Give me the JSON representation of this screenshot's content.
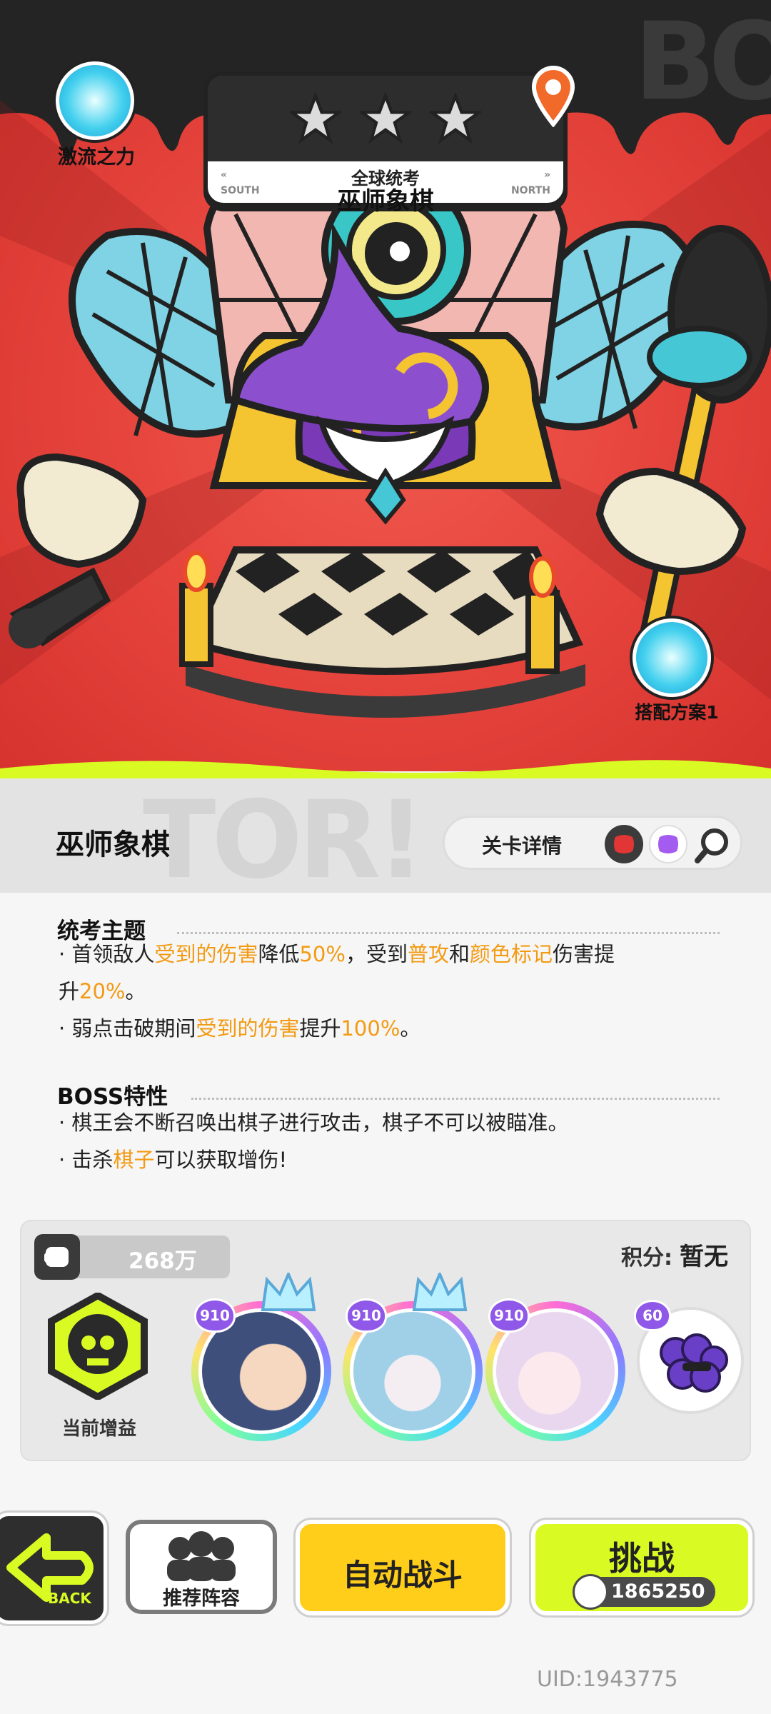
{
  "stage": {
    "name": "巫师象棋",
    "category": "全球统考",
    "direction_left": "SOUTH",
    "direction_right": "NORTH",
    "stars": 3
  },
  "badges": {
    "power_label": "激流之力",
    "plan_label": "搭配方案1"
  },
  "panel": {
    "title": "巫师象棋",
    "details_label": "关卡详情",
    "theme": {
      "heading": "统考主题",
      "bullets": [
        [
          {
            "t": "·  首领敌人"
          },
          {
            "t": "受到的伤害",
            "hl": true
          },
          {
            "t": "降低"
          },
          {
            "t": "50%",
            "hl": true
          },
          {
            "t": "，受到"
          },
          {
            "t": "普攻",
            "hl": true
          },
          {
            "t": "和"
          },
          {
            "t": "颜色标记",
            "hl": true
          },
          {
            "t": "伤害提"
          }
        ],
        [
          {
            "t": "升"
          },
          {
            "t": "20%",
            "hl": true
          },
          {
            "t": "。"
          }
        ],
        [
          {
            "t": "·  弱点击破期间"
          },
          {
            "t": "受到的伤害",
            "hl": true
          },
          {
            "t": "提升"
          },
          {
            "t": "100%",
            "hl": true
          },
          {
            "t": "。"
          }
        ]
      ]
    },
    "boss": {
      "heading": "BOSS特性",
      "bullets": [
        [
          {
            "t": "·  棋王会不断召唤出棋子进行攻击，棋子不可以被瞄准。"
          }
        ],
        [
          {
            "t": "·  击杀"
          },
          {
            "t": "棋子",
            "hl": true
          },
          {
            "t": "可以获取增伤!"
          }
        ]
      ]
    }
  },
  "team": {
    "power": "268万",
    "score_label": "积分:",
    "score_value": "暂无",
    "buff_label": "当前增益",
    "heroes": [
      {
        "level": "910",
        "face": "#3d4f7a"
      },
      {
        "level": "910",
        "face": "#9fd0e8"
      },
      {
        "level": "910",
        "face": "#e9d6ef"
      }
    ],
    "pet_level": "60"
  },
  "buttons": {
    "back": "BACK",
    "recommend": "推荐阵容",
    "auto": "自动战斗",
    "fight": "挑战",
    "fight_power": "1865250"
  },
  "uid": "UID:1943775",
  "colors": {
    "highlight": "#f39a12",
    "hero_bg": "#e7463e",
    "lime": "#d9fb23",
    "auto_yellow": "#ffce1a"
  }
}
